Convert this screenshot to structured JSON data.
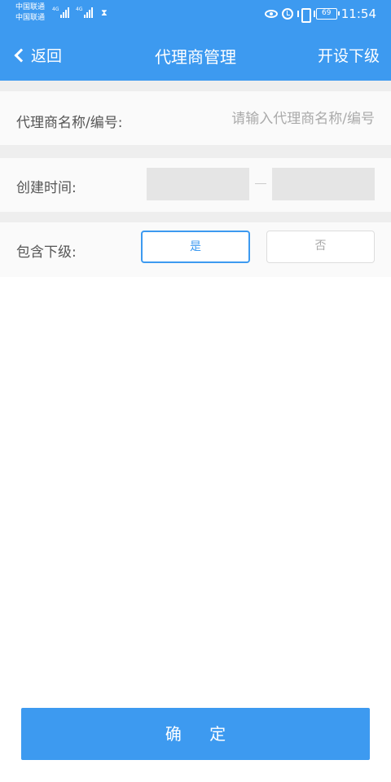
{
  "statusbar": {
    "carrier1": "中国联通",
    "carrier2": "中国联通",
    "network1": "4G",
    "network2": "4G",
    "battery": "69",
    "time": "11:54"
  },
  "navbar": {
    "back_label": "返回",
    "title": "代理商管理",
    "action_label": "开设下级"
  },
  "form": {
    "name": {
      "label": "代理商名称/编号:",
      "placeholder": "请输入代理商名称/编号",
      "value": ""
    },
    "created": {
      "label": "创建时间:",
      "start": "",
      "end": ""
    },
    "include_sub": {
      "label": "包含下级:",
      "options": [
        "是",
        "否"
      ],
      "selected": "是"
    }
  },
  "confirm_label": "确 定",
  "colors": {
    "primary": "#3d9af0",
    "band": "#eeeeee",
    "row_bg": "#fafafa",
    "label_text": "#555555",
    "placeholder": "#aaaaaa"
  }
}
